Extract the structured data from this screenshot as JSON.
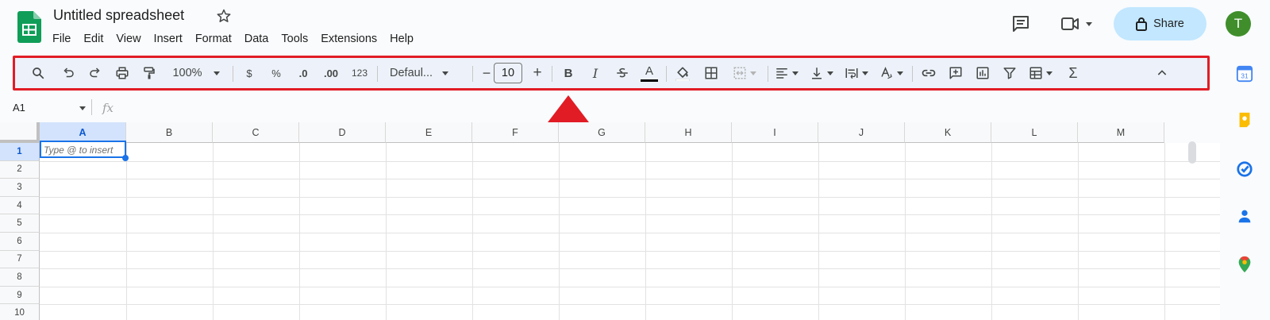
{
  "doc": {
    "title": "Untitled spreadsheet"
  },
  "menu": [
    "File",
    "Edit",
    "View",
    "Insert",
    "Format",
    "Data",
    "Tools",
    "Extensions",
    "Help"
  ],
  "header": {
    "share_label": "Share",
    "avatar_initial": "T"
  },
  "toolbar": {
    "zoom": "100%",
    "currency": "$",
    "percent": "%",
    "dec_decrease": ".0",
    "dec_increase": ".00",
    "more_formats": "123",
    "font": "Defaul...",
    "font_size": "10",
    "minus": "−",
    "plus": "+",
    "bold": "B",
    "italic": "I",
    "text_color_letter": "A",
    "sigma": "Σ"
  },
  "formula_bar": {
    "cell_ref": "A1",
    "fx": "fx"
  },
  "columns": [
    "A",
    "B",
    "C",
    "D",
    "E",
    "F",
    "G",
    "H",
    "I",
    "J",
    "K",
    "L",
    "M"
  ],
  "rows": [
    "1",
    "2",
    "3",
    "4",
    "5",
    "6",
    "7",
    "8",
    "9",
    "10"
  ],
  "active_cell": {
    "placeholder": "Type @ to insert"
  },
  "colors": {
    "brand_green": "#0f9d58",
    "share_bg": "#c2e7ff",
    "highlight_border": "#e11c25",
    "selection_blue": "#1a73e8"
  }
}
